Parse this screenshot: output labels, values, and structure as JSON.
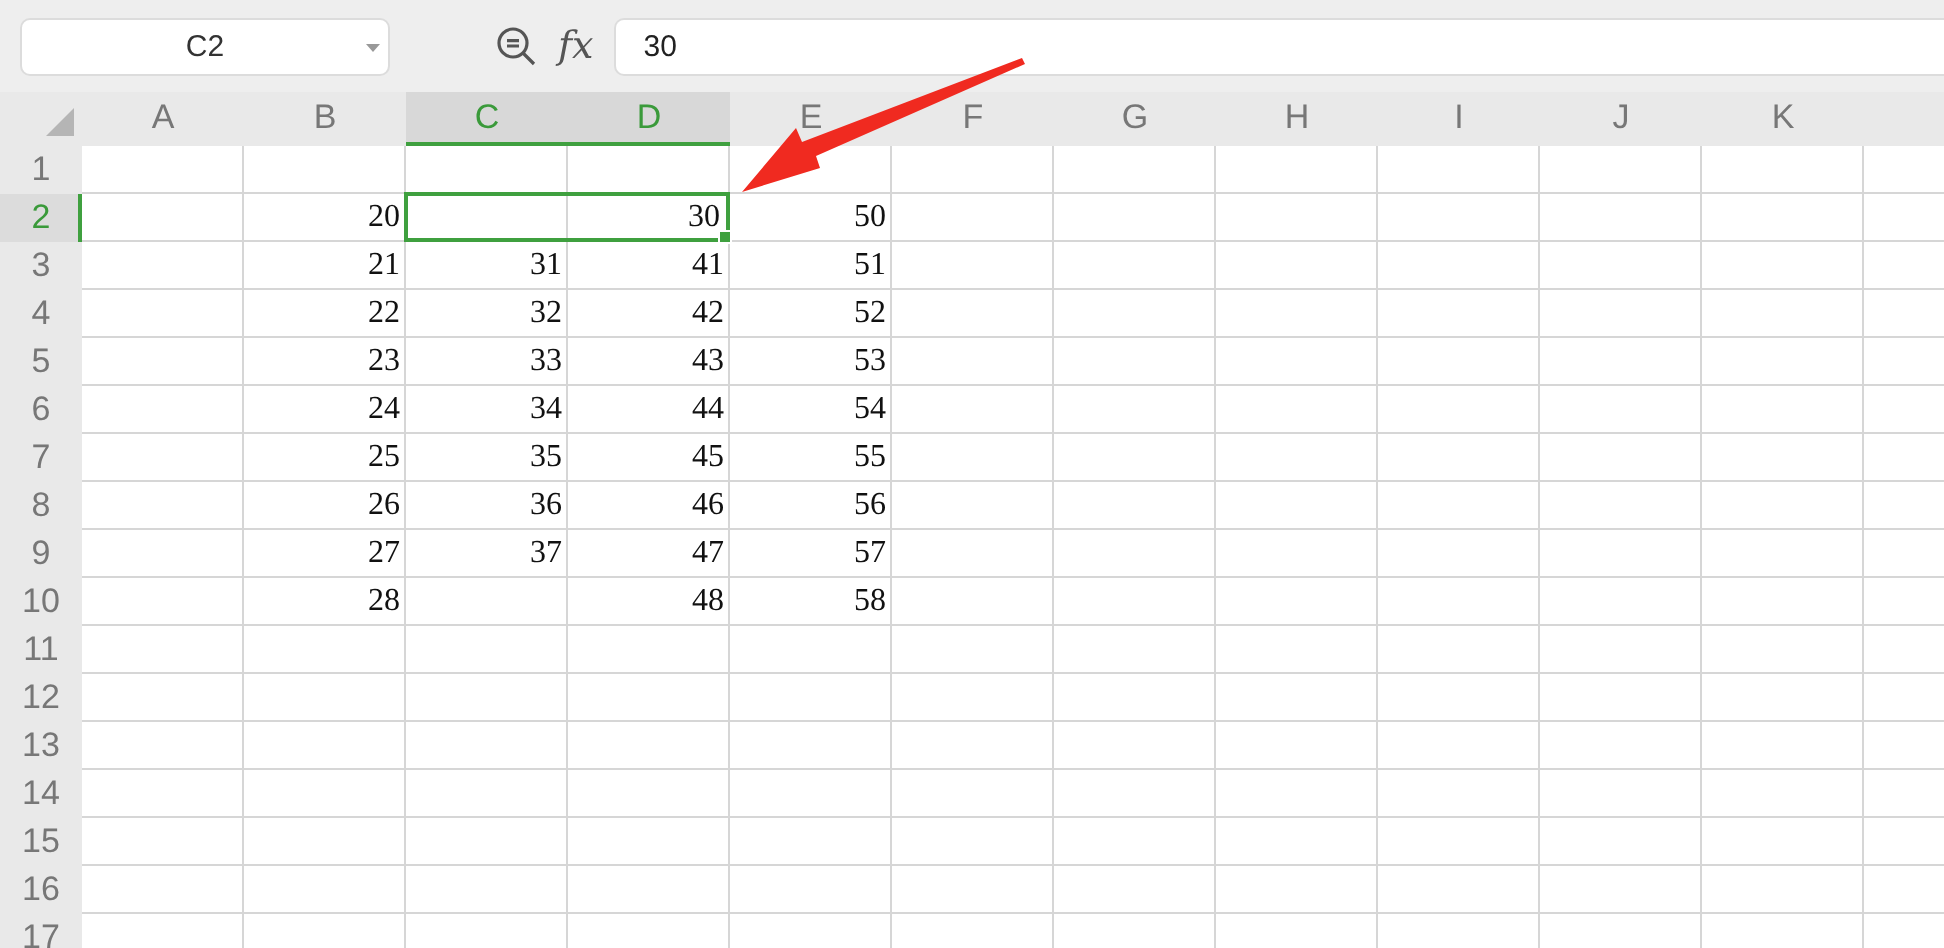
{
  "formula_bar": {
    "name_box": "C2",
    "function_label": "fx",
    "value": "30"
  },
  "columns": [
    {
      "label": "A",
      "selected": false
    },
    {
      "label": "B",
      "selected": false
    },
    {
      "label": "C",
      "selected": true
    },
    {
      "label": "D",
      "selected": true
    },
    {
      "label": "E",
      "selected": false
    },
    {
      "label": "F",
      "selected": false
    },
    {
      "label": "G",
      "selected": false
    },
    {
      "label": "H",
      "selected": false
    },
    {
      "label": "I",
      "selected": false
    },
    {
      "label": "J",
      "selected": false
    },
    {
      "label": "K",
      "selected": false
    }
  ],
  "rows": [
    {
      "label": "1",
      "selected": false,
      "cells": []
    },
    {
      "label": "2",
      "selected": true,
      "cells": [
        "",
        "20",
        {
          "value": "30",
          "merged": true,
          "selected": true
        },
        "50"
      ]
    },
    {
      "label": "3",
      "selected": false,
      "cells": [
        "",
        "21",
        "31",
        "41",
        "51"
      ]
    },
    {
      "label": "4",
      "selected": false,
      "cells": [
        "",
        "22",
        "32",
        "42",
        "52"
      ]
    },
    {
      "label": "5",
      "selected": false,
      "cells": [
        "",
        "23",
        "33",
        "43",
        "53"
      ]
    },
    {
      "label": "6",
      "selected": false,
      "cells": [
        "",
        "24",
        "34",
        "44",
        "54"
      ]
    },
    {
      "label": "7",
      "selected": false,
      "cells": [
        "",
        "25",
        "35",
        "45",
        "55"
      ]
    },
    {
      "label": "8",
      "selected": false,
      "cells": [
        "",
        "26",
        "36",
        "46",
        "56"
      ]
    },
    {
      "label": "9",
      "selected": false,
      "cells": [
        "",
        "27",
        "37",
        "47",
        "57"
      ]
    },
    {
      "label": "10",
      "selected": false,
      "cells": [
        "",
        "28",
        "",
        "48",
        "58"
      ]
    },
    {
      "label": "11",
      "selected": false,
      "cells": []
    },
    {
      "label": "12",
      "selected": false,
      "cells": []
    },
    {
      "label": "13",
      "selected": false,
      "cells": []
    },
    {
      "label": "14",
      "selected": false,
      "cells": []
    },
    {
      "label": "15",
      "selected": false,
      "cells": []
    },
    {
      "label": "16",
      "selected": false,
      "cells": []
    },
    {
      "label": "17",
      "selected": false,
      "cells": []
    }
  ]
}
